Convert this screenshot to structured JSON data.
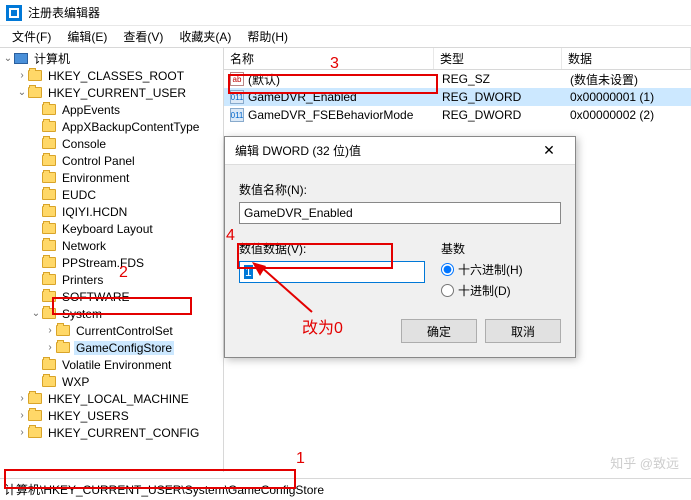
{
  "window": {
    "title": "注册表编辑器"
  },
  "menu": {
    "file": "文件(F)",
    "edit": "编辑(E)",
    "view": "查看(V)",
    "fav": "收藏夹(A)",
    "help": "帮助(H)"
  },
  "tree": {
    "root": "计算机",
    "hkcr": "HKEY_CLASSES_ROOT",
    "hkcu": "HKEY_CURRENT_USER",
    "hkcu_children": [
      "AppEvents",
      "AppXBackupContentType",
      "Console",
      "Control Panel",
      "Environment",
      "EUDC",
      "IQIYI.HCDN",
      "Keyboard Layout",
      "Network",
      "PPStream.FDS",
      "Printers",
      "SOFTWARE"
    ],
    "system": "System",
    "system_children": [
      "CurrentControlSet",
      "GameConfigStore"
    ],
    "hkcu_tail": [
      "Volatile Environment",
      "WXP"
    ],
    "hklm": "HKEY_LOCAL_MACHINE",
    "hku": "HKEY_USERS",
    "hkcc": "HKEY_CURRENT_CONFIG"
  },
  "columns": {
    "name": "名称",
    "type": "类型",
    "data": "数据"
  },
  "rows": [
    {
      "icon": "sz",
      "name": "(默认)",
      "type": "REG_SZ",
      "data": "(数值未设置)"
    },
    {
      "icon": "bin",
      "name": "GameDVR_Enabled",
      "type": "REG_DWORD",
      "data": "0x00000001 (1)"
    },
    {
      "icon": "bin",
      "name": "GameDVR_FSEBehaviorMode",
      "type": "REG_DWORD",
      "data": "0x00000002 (2)"
    }
  ],
  "dialog": {
    "title": "编辑 DWORD (32 位)值",
    "name_label": "数值名称(N):",
    "name_value": "GameDVR_Enabled",
    "data_label": "数值数据(V):",
    "data_value": "1",
    "base_label": "基数",
    "radix_hex": "十六进制(H)",
    "radix_dec": "十进制(D)",
    "ok": "确定",
    "cancel": "取消"
  },
  "status": {
    "path": "计算机\\HKEY_CURRENT_USER\\System\\GameConfigStore"
  },
  "annot": {
    "n1": "1",
    "n2": "2",
    "n3": "3",
    "n4": "4",
    "hint": "改为0"
  },
  "watermark": "知乎 @致远"
}
